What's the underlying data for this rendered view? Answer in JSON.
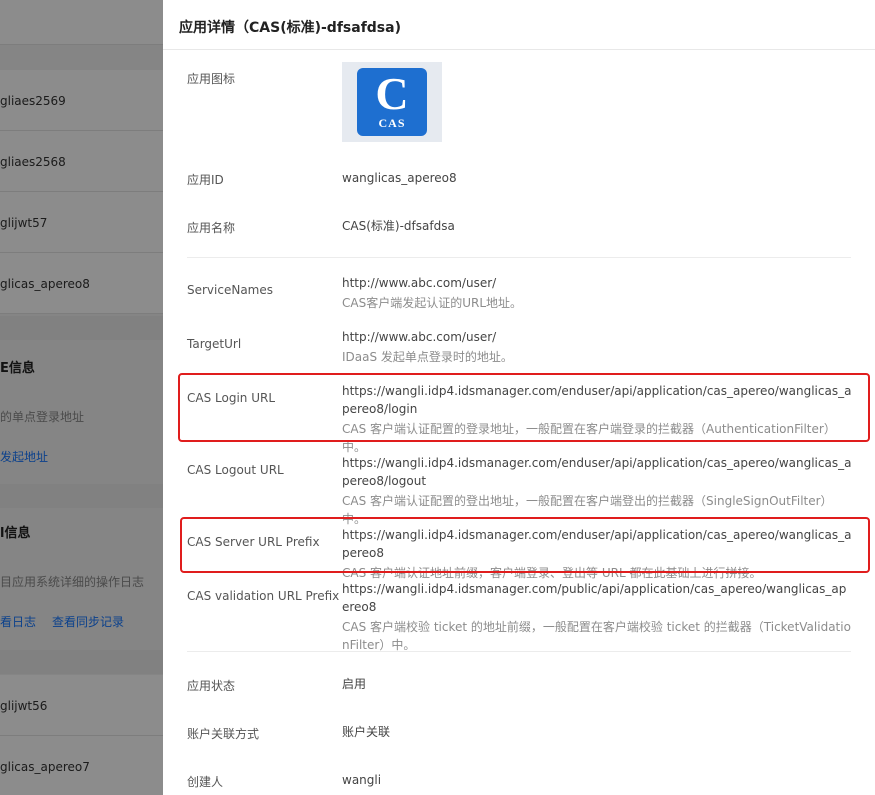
{
  "background_list": {
    "items": [
      {
        "label": "gliaes2569"
      },
      {
        "label": "gliaes2568"
      },
      {
        "label": "glijwt57"
      },
      {
        "label": "glicas_apereo8"
      }
    ],
    "section1_title": "E信息",
    "section1_desc": "的单点登录地址",
    "section1_link": "发起地址",
    "section2_title": "l信息",
    "section2_desc": "目应用系统详细的操作日志",
    "section2_link1": "看日志",
    "section2_link2": "查看同步记录",
    "items2": [
      {
        "label": "glijwt56"
      },
      {
        "label": "glicas_apereo7"
      }
    ]
  },
  "drawer": {
    "title": "应用详情（CAS(标准)-dfsafdsa)",
    "icon": {
      "big": "C",
      "small": "CAS",
      "color": "#1e6fd0"
    },
    "rows": {
      "app_icon": {
        "label": "应用图标"
      },
      "app_id": {
        "label": "应用ID",
        "value": "wanglicas_apereo8"
      },
      "app_name": {
        "label": "应用名称",
        "value": "CAS(标准)-dfsafdsa"
      },
      "service_names": {
        "label": "ServiceNames",
        "value": "http://www.abc.com/user/",
        "desc": "CAS客户端发起认证的URL地址。"
      },
      "target_url": {
        "label": "TargetUrl",
        "value": "http://www.abc.com/user/",
        "desc": "IDaaS 发起单点登录时的地址。"
      },
      "login_url": {
        "label": "CAS Login URL",
        "value": "https://wangli.idp4.idsmanager.com/enduser/api/application/cas_apereo/wanglicas_apereo8/login",
        "desc": "CAS 客户端认证配置的登录地址，一般配置在客户端登录的拦截器（AuthenticationFilter）中。"
      },
      "logout_url": {
        "label": "CAS Logout URL",
        "value": "https://wangli.idp4.idsmanager.com/enduser/api/application/cas_apereo/wanglicas_apereo8/logout",
        "desc": "CAS 客户端认证配置的登出地址，一般配置在客户端登出的拦截器（SingleSignOutFilter）中。"
      },
      "server_prefix": {
        "label": "CAS Server URL Prefix",
        "value": "https://wangli.idp4.idsmanager.com/enduser/api/application/cas_apereo/wanglicas_apereo8",
        "desc": "CAS 客户端认证地址前缀，客户端登录、登出等 URL 都在此基础上进行拼接。"
      },
      "validation_prefix": {
        "label": "CAS validation URL Prefix",
        "value": "https://wangli.idp4.idsmanager.com/public/api/application/cas_apereo/wanglicas_apereo8",
        "desc": "CAS 客户端校验 ticket 的地址前缀，一般配置在客户端校验 ticket 的拦截器（TicketValidationFilter）中。"
      },
      "status": {
        "label": "应用状态",
        "value": "启用"
      },
      "account_link": {
        "label": "账户关联方式",
        "value": "账户关联"
      },
      "creator": {
        "label": "创建人",
        "value": "wangli"
      }
    }
  },
  "colors": {
    "highlight": "#e01d1d",
    "link": "#1677ff"
  }
}
